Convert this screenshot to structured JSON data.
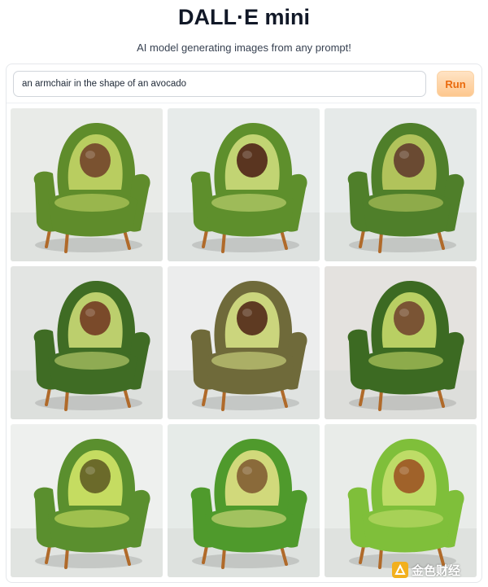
{
  "app": {
    "title": "DALL·E mini",
    "subtitle": "AI model generating images from any prompt!"
  },
  "prompt": {
    "value": "an armchair in the shape of an avocado",
    "run_label": "Run"
  },
  "results": [
    {
      "label": "generated-image-1",
      "bg": "#e9ebe8",
      "fabric": "#5f8c2b",
      "pit": "#7a5230",
      "flesh": "#c9d86a"
    },
    {
      "label": "generated-image-2",
      "bg": "#e7ebea",
      "fabric": "#5e8f2c",
      "pit": "#5a3520",
      "flesh": "#d4e080"
    },
    {
      "label": "generated-image-3",
      "bg": "#e6eae9",
      "fabric": "#4f7f2a",
      "pit": "#6a4a32",
      "flesh": "#c2cf64"
    },
    {
      "label": "generated-image-4",
      "bg": "#e3e5e3",
      "fabric": "#3f6c24",
      "pit": "#7a4a2a",
      "flesh": "#d2e07a"
    },
    {
      "label": "generated-image-5",
      "bg": "#eceded",
      "fabric": "#6f6a3a",
      "pit": "#5e3a22",
      "flesh": "#dce88a"
    },
    {
      "label": "generated-image-6",
      "bg": "#e4e2df",
      "fabric": "#3c6a22",
      "pit": "#7a5434",
      "flesh": "#cfe06e"
    },
    {
      "label": "generated-image-7",
      "bg": "#eef0ee",
      "fabric": "#5a8f2e",
      "pit": "#6b6a2a",
      "flesh": "#d8ea6a"
    },
    {
      "label": "generated-image-8",
      "bg": "#e6ebe8",
      "fabric": "#4f9a2c",
      "pit": "#8a6a3a",
      "flesh": "#e7e48a"
    },
    {
      "label": "generated-image-9",
      "bg": "#e9ece9",
      "fabric": "#7fbf3a",
      "pit": "#a0622a",
      "flesh": "#c9e070"
    }
  ],
  "watermark": {
    "text": "金色财经"
  }
}
